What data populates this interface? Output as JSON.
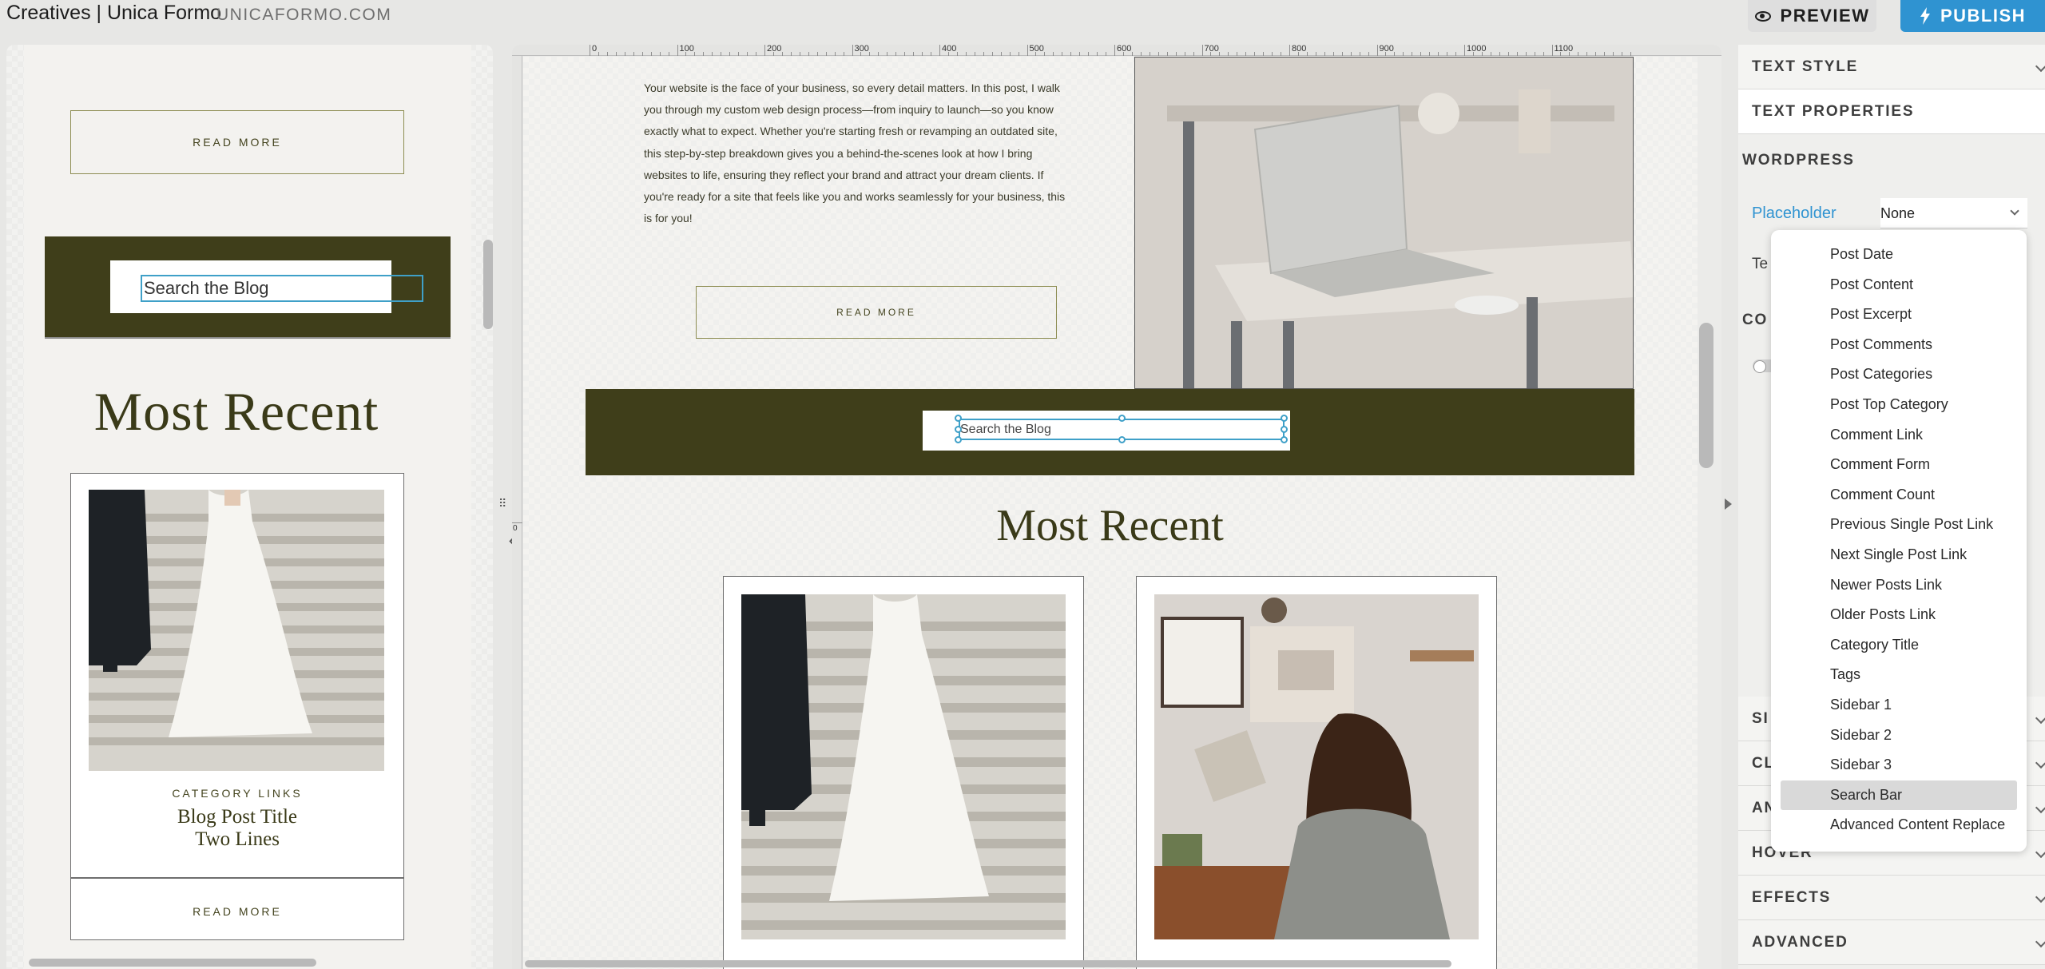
{
  "header": {
    "site_title": "Creatives | Unica Formo",
    "site_url": "UNICAFORMO.COM",
    "preview_label": "PREVIEW",
    "publish_label": "PUBLISH"
  },
  "mobile": {
    "read_more": "READ MORE",
    "search_value": "Search the Blog",
    "heading": "Most Recent",
    "card": {
      "category": "CATEGORY LINKS",
      "title_line1": "Blog Post Title",
      "title_line2": "Two Lines",
      "read_more": "READ MORE"
    }
  },
  "canvas": {
    "ruler_top": [
      "0",
      "100",
      "200",
      "300",
      "400",
      "500",
      "600",
      "700",
      "800",
      "900",
      "1000",
      "1100"
    ],
    "ruler_left": [
      "0"
    ],
    "intro_text": "Your website is the face of your business, so every detail matters. In this post, I walk you through my custom web design process—from inquiry to launch—so you know exactly what to expect. Whether you're starting fresh or revamping an outdated site, this step-by-step breakdown gives you a behind-the-scenes look at how I bring websites to life, ensuring they reflect your brand and attract your dream clients. If you're ready for a site that feels like you and works seamlessly for your business, this is for you!",
    "read_more": "READ MORE",
    "search_value": "Search the Blog",
    "heading": "Most Recent"
  },
  "sidebar": {
    "text_style": "TEXT STYLE",
    "text_properties": "TEXT PROPERTIES",
    "wordpress": "WORDPRESS",
    "placeholder_label": "Placeholder",
    "placeholder_value": "None",
    "partial_te": "Te",
    "partial_co": "CO",
    "partial_si": "SI",
    "partial_cl": "CL",
    "partial_an": "AN",
    "hover": "HOVER",
    "effects": "EFFECTS",
    "advanced": "ADVANCED"
  },
  "dropdown": {
    "items": [
      "Post Date",
      "Post Content",
      "Post Excerpt",
      "Post Comments",
      "Post Categories",
      "Post Top Category",
      "Comment Link",
      "Comment Form",
      "Comment Count",
      "Previous Single Post Link",
      "Next Single Post Link",
      "Newer Posts Link",
      "Older Posts Link",
      "Category Title",
      "Tags",
      "Sidebar 1",
      "Sidebar 2",
      "Sidebar 3",
      "Search Bar",
      "Advanced Content Replace"
    ],
    "selected_index": 18
  },
  "colors": {
    "olive": "#3f3e1a",
    "accent_blue": "#2f93d1",
    "selection_blue": "#3fa0c8"
  }
}
